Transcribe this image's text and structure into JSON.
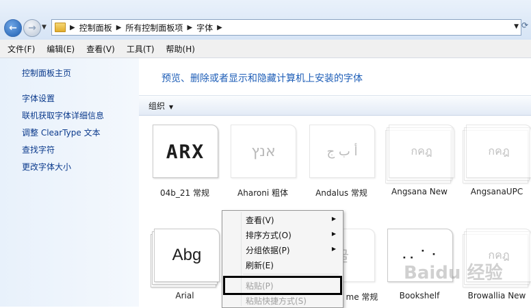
{
  "address_bar": {
    "crumbs": [
      "控制面板",
      "所有控制面板项",
      "字体"
    ]
  },
  "menubar": [
    "文件(F)",
    "编辑(E)",
    "查看(V)",
    "工具(T)",
    "帮助(H)"
  ],
  "sidebar": {
    "home": "控制面板主页",
    "links": [
      "字体设置",
      "联机获取字体详细信息",
      "调整 ClearType 文本",
      "查找字符",
      "更改字体大小"
    ]
  },
  "main": {
    "heading": "预览、删除或者显示和隐藏计算机上安装的字体",
    "organize": "组织"
  },
  "fonts": [
    {
      "label": "04b_21 常规",
      "sample": "ARX"
    },
    {
      "label": "Aharoni 粗体",
      "sample": "אנץ"
    },
    {
      "label": "Andalus 常规",
      "sample": "أ ب ج"
    },
    {
      "label": "Angsana New",
      "sample": "กคฎ"
    },
    {
      "label": "AngsanaUPC",
      "sample": "กคฎ"
    },
    {
      "label": "Arial",
      "sample": "Abg"
    },
    {
      "label": "me 常规",
      "sample": "글"
    },
    {
      "label": "Bookshelf",
      "sample": "⠠⠄⠁⠂"
    },
    {
      "label": "Browallia New",
      "sample": "กคฎ"
    }
  ],
  "context_menu": {
    "items": [
      "查看(V)",
      "排序方式(O)",
      "分组依据(P)",
      "刷新(E)",
      "粘贴(P)",
      "粘贴快捷方式(S)"
    ]
  },
  "watermark": "Baidu 经验"
}
